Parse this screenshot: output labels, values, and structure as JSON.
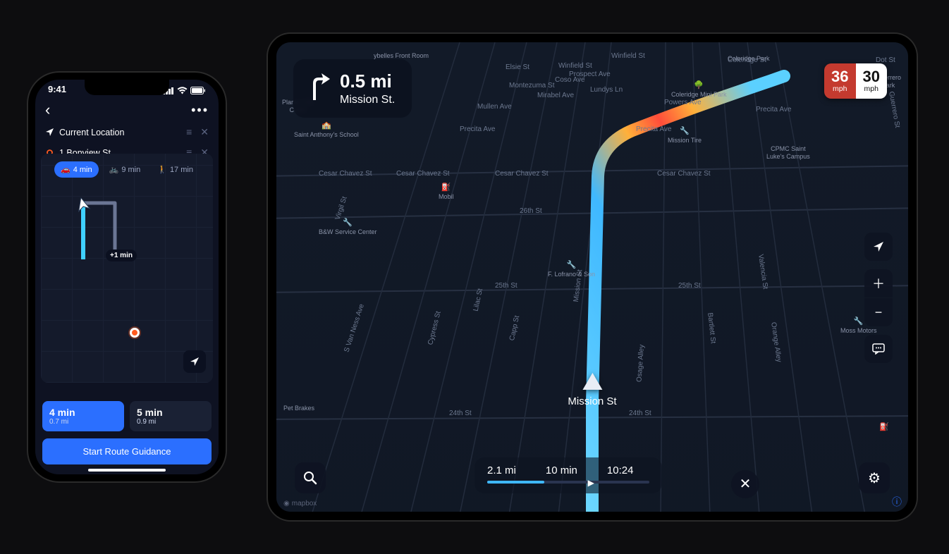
{
  "phone": {
    "time": "9:41",
    "back": "‹",
    "more": "•••",
    "origin_label": "Current Location",
    "dest_label": "1 Bonview St",
    "modes": [
      {
        "icon": "🚗",
        "label": "4 min"
      },
      {
        "icon": "🚲",
        "label": "9 min"
      },
      {
        "icon": "🚶",
        "label": "17 min"
      }
    ],
    "alt_badge": "+1 min",
    "routes": [
      {
        "time": "4 min",
        "dist": "0.7 mi",
        "selected": true
      },
      {
        "time": "5 min",
        "dist": "0.9 mi",
        "selected": false
      }
    ],
    "start_label": "Start Route Guidance"
  },
  "tablet": {
    "turn": {
      "distance": "0.5 mi",
      "street": "Mission St."
    },
    "speed": {
      "current": "36",
      "limit": "30",
      "unit": "mph"
    },
    "current_street": "Mission St",
    "trip": {
      "distance": "2.1 mi",
      "duration": "10 min",
      "eta": "10:24"
    },
    "controls": {
      "compass": "➤",
      "zoom_in": "＋",
      "zoom_out": "−",
      "feedback": "⋯",
      "search": "🔍",
      "close": "✕",
      "gear": "⚙",
      "info": "ⓘ"
    },
    "streets": {
      "cesar_chavez": "Cesar Chavez St",
      "precita": "Precita Ave",
      "26th": "26th St",
      "25th": "25th St",
      "24th": "24th St",
      "s_van_ness": "S Van Ness Ave",
      "capp": "Capp St",
      "mission": "Mission St",
      "bartlett": "Bartlett St",
      "valencia": "Valencia St",
      "orange": "Orange Alley",
      "osage": "Osage Alley",
      "cypress": "Cypress St",
      "lilac": "Lilac St",
      "virgil": "Virgil St",
      "winfield": "Winfield St",
      "elsie": "Elsie St",
      "prospect": "Prospect Ave",
      "montezuma": "Montezuma St",
      "coso": "Coso Ave",
      "mirabel": "Mirabel Ave",
      "mullen": "Mullen Ave",
      "powers": "Powers Ave",
      "coleridge": "Coleridge St",
      "lundys": "Lundys Ln",
      "guerrero": "Guerrero St",
      "dot": "Dot St"
    },
    "pois": {
      "mobil": "Mobil",
      "bw": "B&W Service Center",
      "lofrano": "F. Lofrano & Son",
      "mission_tire": "Mission Tire",
      "moss": "Moss Motors",
      "coleridge_park": "Coleridge Mini Park",
      "coleridge_park2": "Coleridge Park",
      "cpmc": "CPMC Saint\nLuke's Campus",
      "guerrero_park": "Guerrero Park",
      "st_anthony": "Saint Anthony's School",
      "cybelles": "ybelles Front Room",
      "planks": "Planks Chil\nCente",
      "brakes": "Pet Brakes"
    },
    "attribution": "mapbox"
  }
}
